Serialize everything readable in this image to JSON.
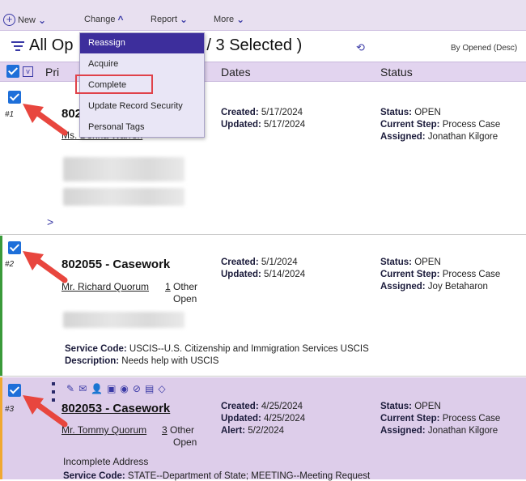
{
  "toolbar": {
    "new_label": "New",
    "change_label": "Change",
    "report_label": "Report",
    "more_label": "More"
  },
  "title": {
    "text": "All Op",
    "count_text": "l 369 / 3 Selected )",
    "sort_text": "By Opened (Desc)"
  },
  "columns": {
    "primary": "Pri",
    "dates": "Dates",
    "status": "Status"
  },
  "change_menu": {
    "items": [
      "Reassign",
      "Acquire",
      "Complete",
      "Update Record Security",
      "Personal Tags"
    ]
  },
  "records": [
    {
      "num": "#1",
      "title": "802",
      "name": "Ms. Donna Warren",
      "created_label": "Created:",
      "created": "5/17/2024",
      "updated_label": "Updated:",
      "updated": "5/17/2024",
      "status_label": "Status:",
      "status": "OPEN",
      "step_label": "Current Step:",
      "step": "Process Case",
      "assigned_label": "Assigned:",
      "assigned": "Jonathan Kilgore",
      "expand": ">"
    },
    {
      "num": "#2",
      "title": "802055 - Casework",
      "name": "Mr. Richard Quorum",
      "other_count": "1",
      "other_text": "Other",
      "open_text": "Open",
      "created_label": "Created:",
      "created": "5/1/2024",
      "updated_label": "Updated:",
      "updated": "5/14/2024",
      "status_label": "Status:",
      "status": "OPEN",
      "step_label": "Current Step:",
      "step": "Process Case",
      "assigned_label": "Assigned:",
      "assigned": "Joy Betaharon",
      "service_label": "Service Code:",
      "service": "USCIS--U.S. Citizenship and Immigration Services USCIS",
      "desc_label": "Description:",
      "desc": "Needs help with USCIS"
    },
    {
      "num": "#3",
      "title": "802053 - Casework",
      "name": "Mr. Tommy Quorum",
      "other_count": "3",
      "other_text": "Other",
      "open_text": "Open",
      "created_label": "Created:",
      "created": "4/25/2024",
      "updated_label": "Updated:",
      "updated": "4/25/2024",
      "alert_label": "Alert:",
      "alert": "5/2/2024",
      "status_label": "Status:",
      "status": "OPEN",
      "step_label": "Current Step:",
      "step": "Process Case",
      "assigned_label": "Assigned:",
      "assigned": "Jonathan Kilgore",
      "address_note": "Incomplete Address",
      "service_label": "Service Code:",
      "service": "STATE--Department of State; MEETING--Meeting Request"
    }
  ],
  "colors": {
    "accent": "#3a3aa6",
    "checkbox": "#1e6fd9",
    "header_bg": "#e2d4ef",
    "menu_active": "#3d2e9c",
    "highlight": "#e0424a",
    "arrow": "#e8463e",
    "record2_bar": "#3a9a3a",
    "record3_bar": "#f0a830"
  }
}
